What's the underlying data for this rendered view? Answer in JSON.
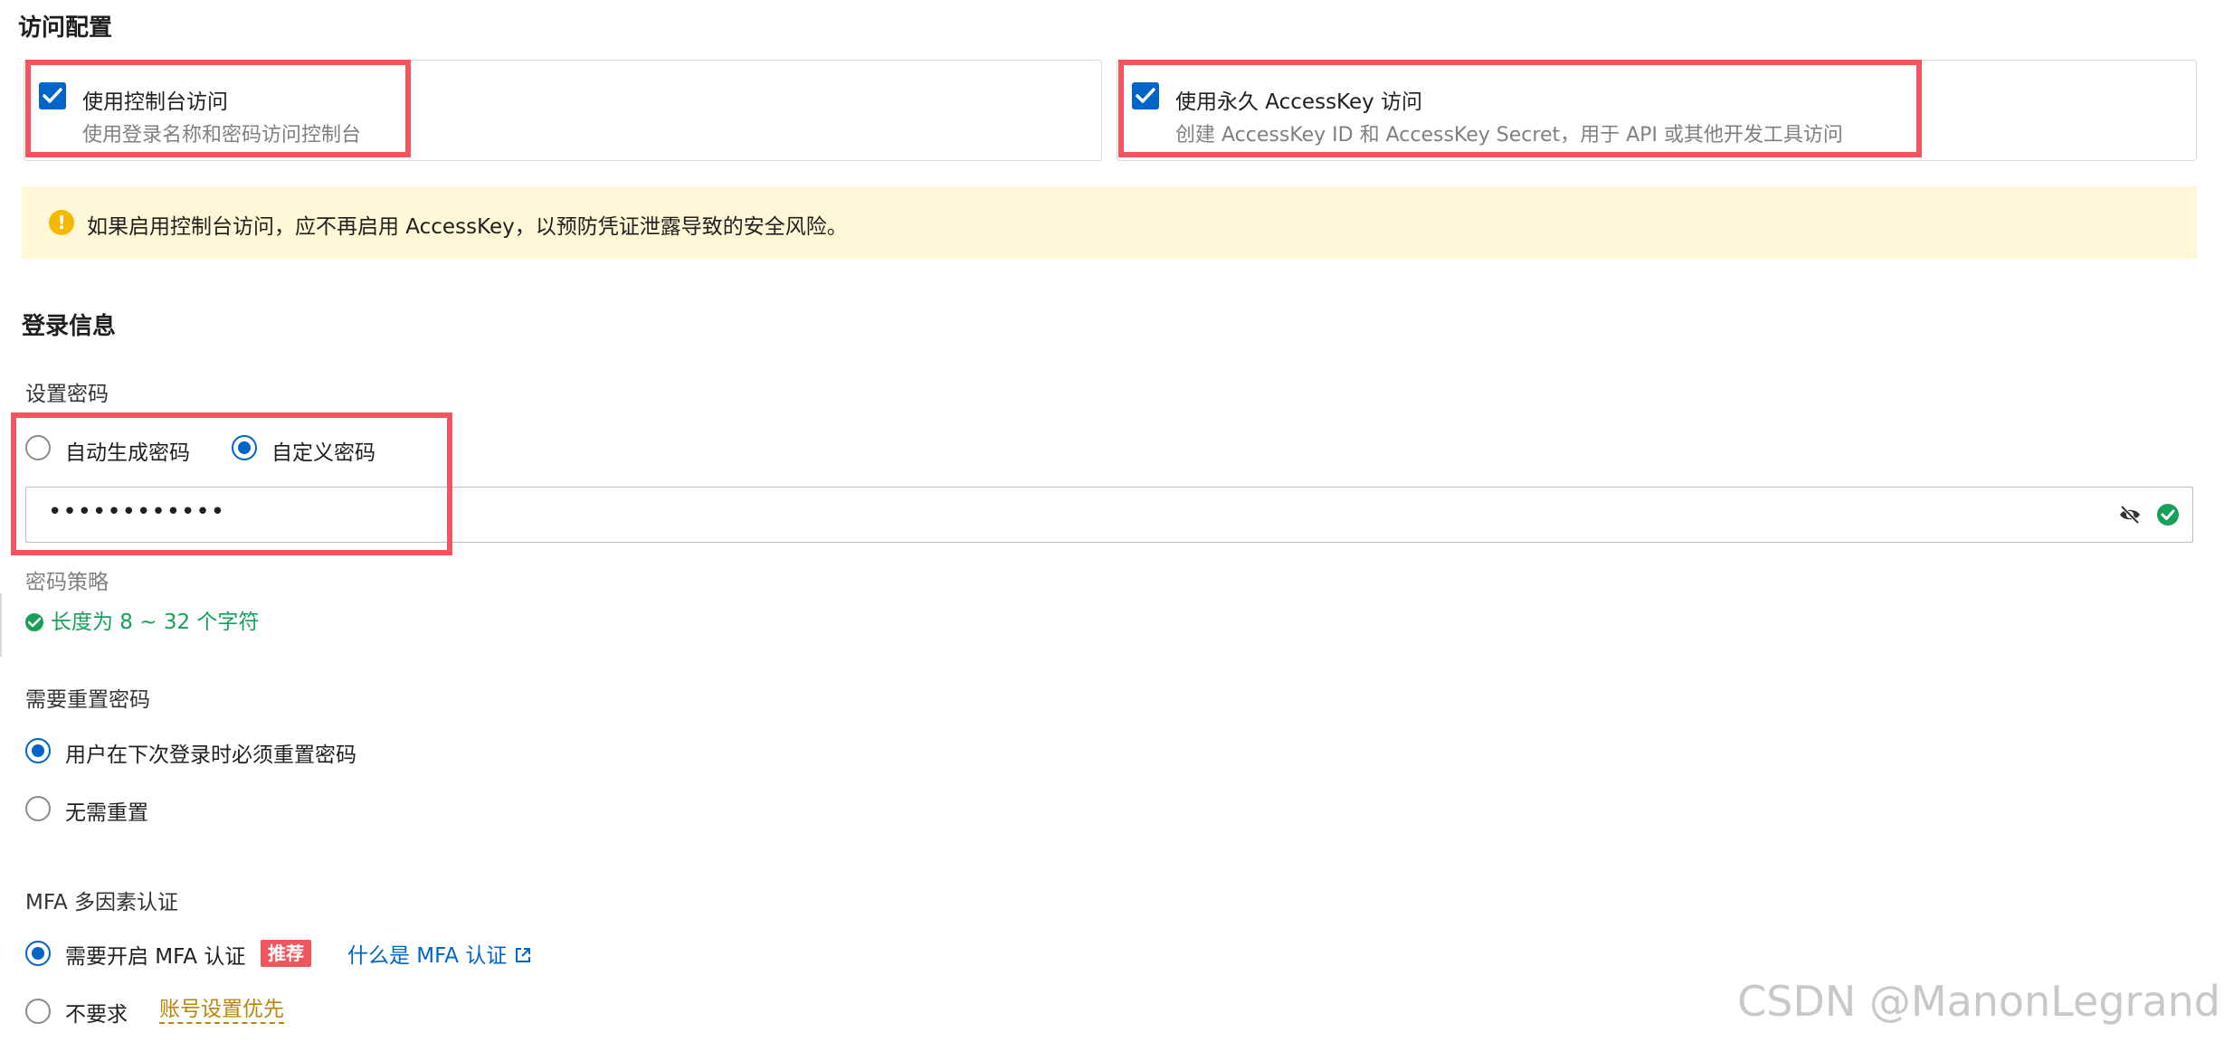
{
  "access_config": {
    "title": "访问配置",
    "console": {
      "label": "使用控制台访问",
      "desc": "使用登录名称和密码访问控制台",
      "checked": true
    },
    "accesskey": {
      "label": "使用永久 AccessKey 访问",
      "desc": "创建 AccessKey ID 和 AccessKey Secret，用于 API 或其他开发工具访问",
      "checked": true
    },
    "alert": "如果启用控制台访问，应不再启用 AccessKey，以预防凭证泄露导致的安全风险。"
  },
  "login_info": {
    "title": "登录信息",
    "password_label": "设置密码",
    "password_options": [
      {
        "label": "自动生成密码",
        "selected": false
      },
      {
        "label": "自定义密码",
        "selected": true
      }
    ],
    "password_value": "••••••••••••",
    "policy_label": "密码策略",
    "policy_rule": "长度为 8 ~ 32 个字符",
    "reset_label": "需要重置密码",
    "reset_options": [
      {
        "label": "用户在下次登录时必须重置密码",
        "selected": true
      },
      {
        "label": "无需重置",
        "selected": false
      }
    ],
    "mfa_label": "MFA 多因素认证",
    "mfa_options": [
      {
        "label": "需要开启 MFA 认证",
        "selected": true
      },
      {
        "label": "不要求",
        "selected": false
      }
    ],
    "mfa_badge": "推荐",
    "mfa_link": "什么是 MFA 认证",
    "account_pref": "账号设置优先"
  },
  "watermark": "CSDN @ManonLegrand",
  "colors": {
    "primary": "#0064c8",
    "highlight": "#f0565e",
    "warning_bg": "#fff7d6",
    "warning_icon": "#f5b800",
    "success": "#18a058",
    "link": "#0064c8"
  },
  "icons": [
    "check-icon",
    "warning-icon",
    "eye-slash-icon",
    "success-check-icon",
    "external-link-icon"
  ]
}
